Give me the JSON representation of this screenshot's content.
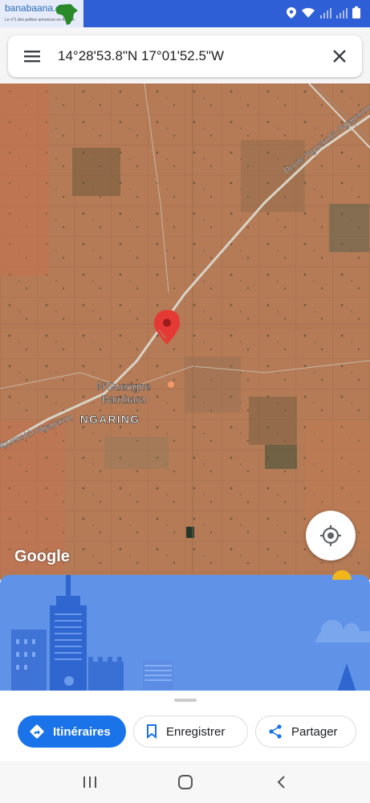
{
  "watermark": {
    "site": "banabaana.com",
    "tagline": "Le n°1 des petites annonces en Afrique"
  },
  "search": {
    "coordinates": "14°28'53.8\"N 17°01'52.5\"W"
  },
  "map": {
    "road_label_upper": "Route Nguekokh-Ngaparou",
    "road_label_lower": "Nguekokh-Ngaparou",
    "place_name": "N'Guerigne Bambara",
    "place_line1": "N'Guerigne",
    "place_line2": "Bambara",
    "town_name": "NGARING",
    "attribution": "Google"
  },
  "actions": {
    "directions_label": "Itinéraires",
    "save_label": "Enregistrer",
    "share_label": "Partager"
  },
  "colors": {
    "accent": "#1a73e8",
    "status_bar": "#2f5fd6",
    "pin": "#e53935",
    "street_view_sky": "#5a8ee6"
  }
}
